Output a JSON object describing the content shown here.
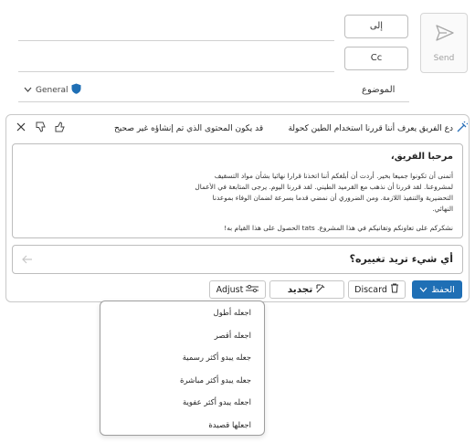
{
  "compose": {
    "send_label": "Send",
    "to_label": "إلى",
    "cc_label": "Cc",
    "subject_label": "الموضوع",
    "sensitivity_label": "General"
  },
  "copilot": {
    "disclaimer": "قد يكون المحتوى الذي تم إنشاؤه غير صحيح",
    "header_text": "دع الفريق يعرف أننا قررنا استخدام الطين كحولة",
    "draft": {
      "greeting": "مرحبا الفريق،",
      "lines": [
        "أتمنى أن تكونوا جميعا بخير. أردت أن أبلغكم أننا اتخذنا قرارا نهائيا بشأن مواد التسقيف",
        "لمشروعنا. لقد قررنا أن نذهب مع القرميد الطيني. لقد قررنا اليوم. يرجى المتابعة في الأعمال",
        "التحضيرية والتنفيذ اللازمة. ومن الضروري أن نمضي قدما بسرعة لضمان الوفاء بموعدنا",
        "النهائي."
      ],
      "closing": "نشكركم على تعاونكم وتفانيكم في هذا المشروع. tats الحصول على هذا القيام به!"
    },
    "prompt_placeholder": "أي شيء تريد تغييره؟",
    "adjust_label": "Adjust",
    "regenerate_label": "تجديد",
    "discard_label": "Discard",
    "keep_label": "الحفظ",
    "menu": [
      "اجعله أطول",
      "اجعله أقصر",
      "جعله يبدو أكثر رسمية",
      "جعله يبدو أكثر مباشرة",
      "اجعله يبدو أكثر عفوية",
      "اجعلها قصيدة"
    ]
  }
}
